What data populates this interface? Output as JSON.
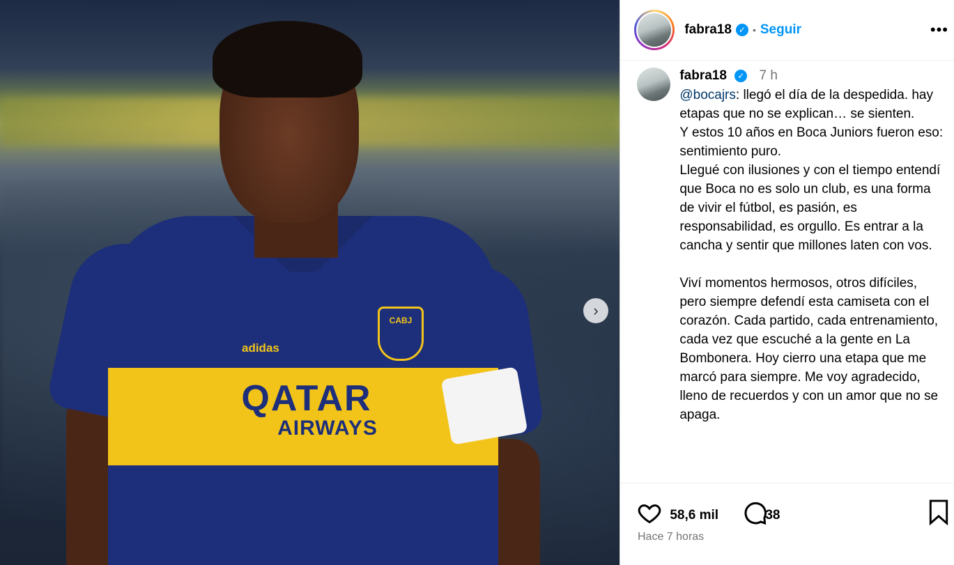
{
  "header": {
    "username": "fabra18",
    "verified_icon": "check",
    "separator": "•",
    "follow_label": "Seguir",
    "more_icon": "•••"
  },
  "media": {
    "next_icon": "›",
    "shirt_brand": "adidas",
    "shirt_crest": "CABJ",
    "shirt_sponsor_line1": "QATAR",
    "shirt_sponsor_line2": "AIRWAYS"
  },
  "caption": {
    "username": "fabra18",
    "verified_icon": "check",
    "time": "7 h",
    "mention": "@bocajrs",
    "text": ": llegó el día de la despedida. hay etapas que no se explican… se sienten.\nY estos 10 años en Boca Juniors fueron eso: sentimiento puro.\nLlegué con ilusiones y con el tiempo entendí que Boca no es solo un club, es una forma de vivir el fútbol, es pasión, es responsabilidad, es orgullo. Es entrar a la cancha y sentir que millones laten con vos.\n\nViví momentos hermosos, otros difíciles, pero siempre defendí esta camiseta con el corazón. Cada partido, cada entrenamiento, cada vez que escuché a la gente en La Bombonera. Hoy cierro una etapa que me marcó para siempre. Me voy agradecido, lleno de recuerdos y con un amor que no se apaga."
  },
  "actions": {
    "likes": "58,6 mil",
    "comments": "38",
    "posted": "Hace 7 horas"
  }
}
